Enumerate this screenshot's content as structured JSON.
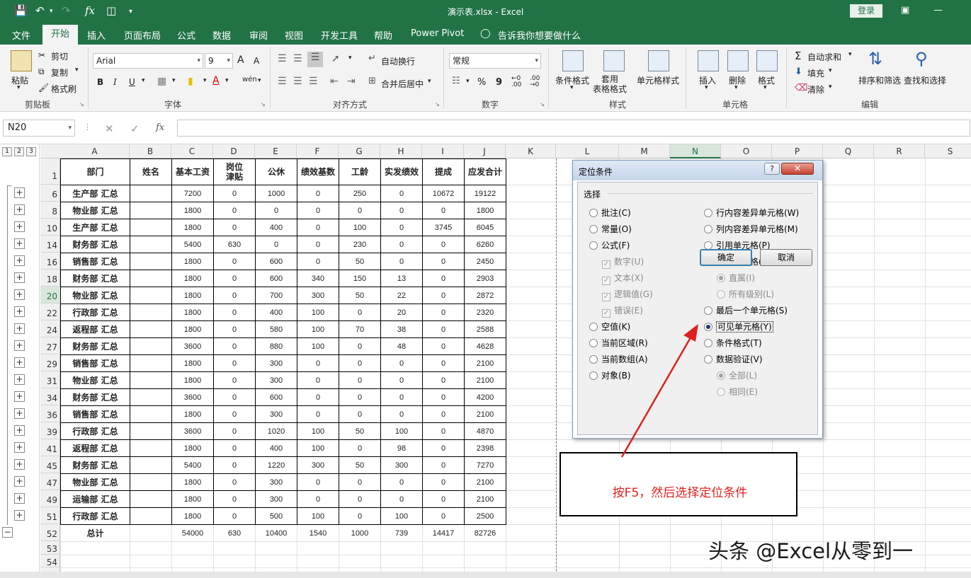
{
  "window": {
    "title": "演示表.xlsx  -  Excel",
    "login": "登录",
    "quick_access": {
      "fx": "fx"
    }
  },
  "menu_tabs": [
    "文件",
    "开始",
    "插入",
    "页面布局",
    "公式",
    "数据",
    "审阅",
    "视图",
    "开发工具",
    "帮助",
    "Power Pivot",
    "告诉我你想要做什么"
  ],
  "ribbon": {
    "clipboard": {
      "paste": "粘贴",
      "cut": "剪切",
      "copy": "复制",
      "format_painter": "格式刷",
      "group": "剪贴板"
    },
    "font": {
      "name": "Arial",
      "size": "9",
      "bold": "B",
      "italic": "I",
      "underline": "U",
      "group": "字体",
      "increase": "A",
      "decrease": "A",
      "wen": "wén"
    },
    "alignment": {
      "wrap": "自动换行",
      "merge": "合并后居中",
      "group": "对齐方式"
    },
    "number": {
      "format": "常规",
      "percent": "%",
      "comma": "9",
      "group": "数字"
    },
    "styles": {
      "cond_format": "条件格式",
      "table_format": "套用\n表格格式",
      "cell_styles": "单元格样式",
      "group": "样式"
    },
    "cells": {
      "insert": "插入",
      "delete": "删除",
      "format": "格式",
      "group": "单元格"
    },
    "editing": {
      "autosum": "自动求和",
      "fill": "填充",
      "clear": "清除",
      "sort_filter": "排序和筛选",
      "find_select": "查找和选择",
      "group": "编辑"
    }
  },
  "formula_bar": {
    "name_box": "N20",
    "fx": "fx"
  },
  "outline_levels": [
    "1",
    "2",
    "3"
  ],
  "columns": [
    "A",
    "B",
    "C",
    "D",
    "E",
    "F",
    "G",
    "H",
    "I",
    "J",
    "K",
    "L",
    "M",
    "N",
    "O",
    "P",
    "Q",
    "R",
    "S"
  ],
  "table": {
    "headers": [
      "部门",
      "姓名",
      "基本工资",
      "岗位\n津贴",
      "公休",
      "绩效基数",
      "工龄",
      "实发绩效",
      "提成",
      "应发合计"
    ],
    "rows": [
      {
        "row": "6",
        "dept": "生产部 汇总",
        "vals": [
          "7200",
          "0",
          "1000",
          "0",
          "250",
          "0",
          "10672",
          "19122"
        ]
      },
      {
        "row": "8",
        "dept": "物业部 汇总",
        "vals": [
          "1800",
          "0",
          "0",
          "0",
          "0",
          "0",
          "0",
          "1800"
        ]
      },
      {
        "row": "10",
        "dept": "生产部 汇总",
        "vals": [
          "1800",
          "0",
          "400",
          "0",
          "100",
          "0",
          "3745",
          "6045"
        ]
      },
      {
        "row": "14",
        "dept": "财务部 汇总",
        "vals": [
          "5400",
          "630",
          "0",
          "0",
          "230",
          "0",
          "0",
          "6260"
        ]
      },
      {
        "row": "16",
        "dept": "销售部 汇总",
        "vals": [
          "1800",
          "0",
          "600",
          "0",
          "50",
          "0",
          "0",
          "2450"
        ]
      },
      {
        "row": "18",
        "dept": "财务部 汇总",
        "vals": [
          "1800",
          "0",
          "600",
          "340",
          "150",
          "13",
          "0",
          "2903"
        ]
      },
      {
        "row": "20",
        "dept": "物业部 汇总",
        "vals": [
          "1800",
          "0",
          "700",
          "300",
          "50",
          "22",
          "0",
          "2872"
        ]
      },
      {
        "row": "22",
        "dept": "行政部 汇总",
        "vals": [
          "1800",
          "0",
          "400",
          "100",
          "0",
          "20",
          "0",
          "2320"
        ]
      },
      {
        "row": "24",
        "dept": "返程部 汇总",
        "vals": [
          "1800",
          "0",
          "580",
          "100",
          "70",
          "38",
          "0",
          "2588"
        ]
      },
      {
        "row": "27",
        "dept": "财务部 汇总",
        "vals": [
          "3600",
          "0",
          "880",
          "100",
          "0",
          "48",
          "0",
          "4628"
        ]
      },
      {
        "row": "29",
        "dept": "销售部 汇总",
        "vals": [
          "1800",
          "0",
          "300",
          "0",
          "0",
          "0",
          "0",
          "2100"
        ]
      },
      {
        "row": "31",
        "dept": "物业部 汇总",
        "vals": [
          "1800",
          "0",
          "300",
          "0",
          "0",
          "0",
          "0",
          "2100"
        ]
      },
      {
        "row": "34",
        "dept": "财务部 汇总",
        "vals": [
          "3600",
          "0",
          "600",
          "0",
          "0",
          "0",
          "0",
          "4200"
        ]
      },
      {
        "row": "36",
        "dept": "销售部 汇总",
        "vals": [
          "1800",
          "0",
          "300",
          "0",
          "0",
          "0",
          "0",
          "2100"
        ]
      },
      {
        "row": "39",
        "dept": "行政部 汇总",
        "vals": [
          "3600",
          "0",
          "1020",
          "100",
          "50",
          "100",
          "0",
          "4870"
        ]
      },
      {
        "row": "41",
        "dept": "返程部 汇总",
        "vals": [
          "1800",
          "0",
          "400",
          "100",
          "0",
          "98",
          "0",
          "2398"
        ]
      },
      {
        "row": "45",
        "dept": "财务部 汇总",
        "vals": [
          "5400",
          "0",
          "1220",
          "300",
          "50",
          "300",
          "0",
          "7270"
        ]
      },
      {
        "row": "47",
        "dept": "物业部 汇总",
        "vals": [
          "1800",
          "0",
          "300",
          "0",
          "0",
          "0",
          "0",
          "2100"
        ]
      },
      {
        "row": "49",
        "dept": "运输部 汇总",
        "vals": [
          "1800",
          "0",
          "300",
          "0",
          "0",
          "0",
          "0",
          "2100"
        ]
      },
      {
        "row": "51",
        "dept": "行政部 汇总",
        "vals": [
          "1800",
          "0",
          "500",
          "100",
          "0",
          "100",
          "0",
          "2500"
        ]
      }
    ],
    "total": {
      "row": "52",
      "dept": "总计",
      "vals": [
        "54000",
        "630",
        "10400",
        "1540",
        "1000",
        "739",
        "14417",
        "82726"
      ]
    },
    "extra_rows": [
      "53",
      "54",
      "55"
    ],
    "header_row": "1"
  },
  "dialog": {
    "title": "定位条件",
    "help": "?",
    "close": "✕",
    "section": "选择",
    "left_options": [
      {
        "label": "批注(C)",
        "kind": "radio",
        "checked": false,
        "disabled": false
      },
      {
        "label": "常量(O)",
        "kind": "radio",
        "checked": false,
        "disabled": false
      },
      {
        "label": "公式(F)",
        "kind": "radio",
        "checked": false,
        "disabled": false
      },
      {
        "label": "数字(U)",
        "kind": "check",
        "checked": true,
        "disabled": true
      },
      {
        "label": "文本(X)",
        "kind": "check",
        "checked": true,
        "disabled": true
      },
      {
        "label": "逻辑值(G)",
        "kind": "check",
        "checked": true,
        "disabled": true
      },
      {
        "label": "错误(E)",
        "kind": "check",
        "checked": true,
        "disabled": true
      },
      {
        "label": "空值(K)",
        "kind": "radio",
        "checked": false,
        "disabled": false
      },
      {
        "label": "当前区域(R)",
        "kind": "radio",
        "checked": false,
        "disabled": false
      },
      {
        "label": "当前数组(A)",
        "kind": "radio",
        "checked": false,
        "disabled": false
      },
      {
        "label": "对象(B)",
        "kind": "radio",
        "checked": false,
        "disabled": false
      }
    ],
    "right_options": [
      {
        "label": "行内容差异单元格(W)",
        "kind": "radio",
        "checked": false,
        "disabled": false
      },
      {
        "label": "列内容差异单元格(M)",
        "kind": "radio",
        "checked": false,
        "disabled": false
      },
      {
        "label": "引用单元格(P)",
        "kind": "radio",
        "checked": false,
        "disabled": false
      },
      {
        "label": "从属单元格(D)",
        "kind": "radio",
        "checked": false,
        "disabled": false
      },
      {
        "label": "直属(I)",
        "kind": "radio",
        "checked": true,
        "disabled": true
      },
      {
        "label": "所有级别(L)",
        "kind": "radio",
        "checked": false,
        "disabled": true
      },
      {
        "label": "最后一个单元格(S)",
        "kind": "radio",
        "checked": false,
        "disabled": false
      },
      {
        "label": "可见单元格(Y)",
        "kind": "radio",
        "checked": true,
        "disabled": false
      },
      {
        "label": "条件格式(T)",
        "kind": "radio",
        "checked": false,
        "disabled": false
      },
      {
        "label": "数据验证(V)",
        "kind": "radio",
        "checked": false,
        "disabled": false
      },
      {
        "label": "全部(L)",
        "kind": "radio",
        "checked": true,
        "disabled": true
      },
      {
        "label": "相同(E)",
        "kind": "radio",
        "checked": false,
        "disabled": true
      }
    ],
    "ok": "确定",
    "cancel": "取消"
  },
  "annotation": {
    "text": "按F5，然后选择定位条件",
    "color": "#e02020"
  },
  "watermark": "头条 @Excel从零到一",
  "colors": {
    "excel_green": "#217346",
    "annotation_red": "#e02020"
  }
}
